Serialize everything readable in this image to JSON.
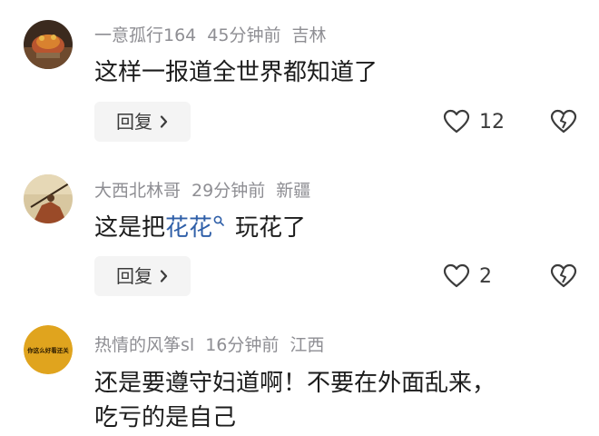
{
  "comments": [
    {
      "username": "一意孤行164",
      "time": "45分钟前",
      "location": "吉林",
      "text": "这样一报道全世界都知道了",
      "reply_label": "回复",
      "like_count": "12"
    },
    {
      "username": "大西北林哥",
      "time": "29分钟前",
      "location": "新疆",
      "text_before": "这是把",
      "topic_link": "花花",
      "text_after": "玩花了",
      "reply_label": "回复",
      "like_count": "2"
    },
    {
      "username": "热情的风筝sl",
      "time": "16分钟前",
      "location": "江西",
      "text_line1": "还是要遵守妇道啊！不要在外面乱来，",
      "text_line2": "吃亏的是自己",
      "avatar_text": "你这么好看还关"
    }
  ],
  "colors": {
    "meta_gray": "#8e8e93",
    "link_blue": "#2f5fa8",
    "reply_bg": "#f4f4f4"
  },
  "icons": {
    "like": "heart-outline-icon",
    "dislike": "broken-heart-icon",
    "reply_arrow": "chevron-right-icon",
    "topic_search": "search-icon"
  }
}
